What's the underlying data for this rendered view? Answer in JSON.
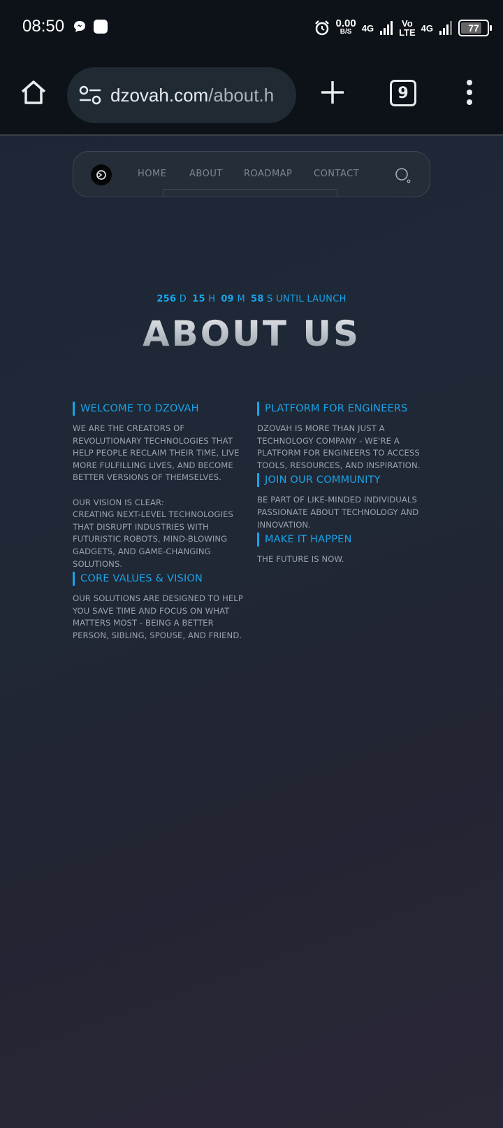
{
  "status_bar": {
    "time": "08:50",
    "net_speed": "0.00",
    "net_unit": "B/S",
    "sim1": "4G",
    "volte_top": "Vo",
    "volte_bottom": "LTE",
    "sim2": "4G",
    "battery": "77",
    "icons": [
      "messenger-icon",
      "app-square-icon",
      "alarm-icon",
      "signal-icon",
      "battery-icon"
    ]
  },
  "browser": {
    "url_host": "dzovah.com",
    "url_path": "/about.h",
    "tab_count": "9",
    "icons": [
      "home-icon",
      "site-settings-icon",
      "new-tab-icon",
      "tabs-icon",
      "more-icon"
    ]
  },
  "site": {
    "nav": {
      "home": "HOME",
      "about": "ABOUT",
      "roadmap": "ROADMAP",
      "contact": "CONTACT"
    },
    "countdown": {
      "days": "256",
      "days_unit": "D",
      "hours": "15",
      "hours_unit": "H",
      "minutes": "09",
      "minutes_unit": "M",
      "seconds": "58",
      "seconds_unit": "S",
      "suffix": "UNTIL LAUNCH"
    },
    "title": "ABOUT US",
    "left": {
      "welcome_head": "WELCOME TO DZOVAH",
      "welcome_p1": "WE ARE THE CREATORS OF REVOLUTIONARY TECHNOLOGIES THAT HELP PEOPLE RECLAIM THEIR TIME, LIVE MORE FULFILLING LIVES, AND BECOME BETTER VERSIONS OF THEMSELVES.",
      "welcome_p2_a": "OUR VISION IS CLEAR:",
      "welcome_p2_b": "CREATING NEXT-LEVEL TECHNOLOGIES THAT DISRUPT INDUSTRIES WITH FUTURISTIC ROBOTS, MIND-BLOWING GADGETS, AND GAME-CHANGING SOLUTIONS.",
      "core_head": "CORE VALUES & VISION",
      "core_p": "OUR SOLUTIONS ARE DESIGNED TO HELP YOU SAVE TIME AND FOCUS ON WHAT MATTERS MOST - BEING A BETTER PERSON, SIBLING, SPOUSE, AND FRIEND."
    },
    "right": {
      "platform_head": "PLATFORM FOR ENGINEERS",
      "platform_p": "DZOVAH IS MORE THAN JUST A TECHNOLOGY COMPANY - WE'RE A PLATFORM FOR ENGINEERS TO ACCESS TOOLS, RESOURCES, AND INSPIRATION.",
      "join_head": "JOIN OUR COMMUNITY",
      "join_p": "BE PART OF LIKE-MINDED INDIVIDUALS PASSIONATE ABOUT TECHNOLOGY AND INNOVATION.",
      "make_head": "MAKE IT HAPPEN",
      "make_p": "THE FUTURE IS NOW."
    },
    "colors": {
      "accent": "#1aa3e8",
      "body_text": "#9aa3ad",
      "nav_text": "#7d8692"
    }
  }
}
